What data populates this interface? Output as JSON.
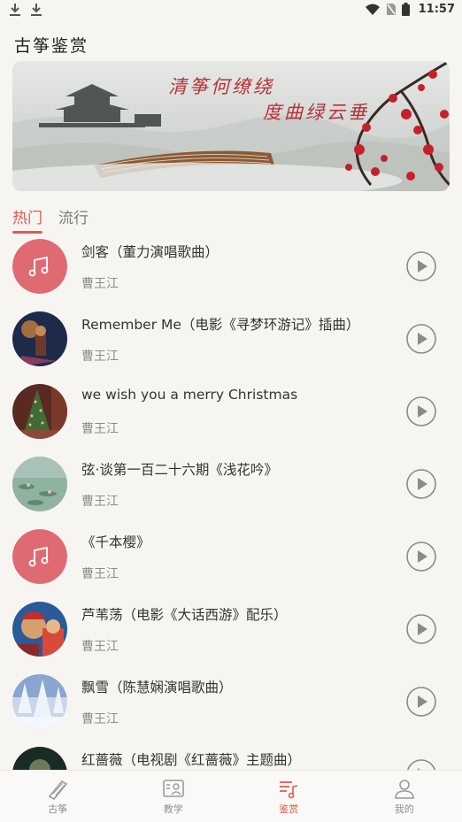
{
  "status_bar": {
    "time": "11:57"
  },
  "page": {
    "title": "古筝鉴赏"
  },
  "banner": {
    "line1": "清筝何缭绕",
    "line2": "度曲绿云垂"
  },
  "tabs": [
    {
      "label": "热门",
      "active": true
    },
    {
      "label": "流行",
      "active": false
    }
  ],
  "songs": [
    {
      "title": "剑客（董力演唱歌曲）",
      "artist": "曹王江",
      "cover": "music-note-placeholder"
    },
    {
      "title": "Remember Me（电影《寻梦环游记》插曲）",
      "artist": "曹王江",
      "cover": "coco-movie"
    },
    {
      "title": "we wish you a merry Christmas",
      "artist": "曹王江",
      "cover": "christmas-tree"
    },
    {
      "title": "弦·谈第一百二十六期《浅花吟》",
      "artist": "曹王江",
      "cover": "water-lilies"
    },
    {
      "title": "《千本樱》",
      "artist": "曹王江",
      "cover": "music-note-placeholder"
    },
    {
      "title": "芦苇荡（电影《大话西游》配乐）",
      "artist": "曹王江",
      "cover": "movie-still"
    },
    {
      "title": "飘雪（陈慧娴演唱歌曲）",
      "artist": "曹王江",
      "cover": "snowy-trees"
    },
    {
      "title": "红蔷薇（电视剧《红蔷薇》主题曲）",
      "artist": "",
      "cover": "dark-portrait"
    }
  ],
  "bottom_nav": [
    {
      "label": "古筝",
      "icon": "guzheng-icon",
      "active": false
    },
    {
      "label": "教学",
      "icon": "teaching-icon",
      "active": false
    },
    {
      "label": "鉴赏",
      "icon": "appreciation-icon",
      "active": true
    },
    {
      "label": "我的",
      "icon": "profile-icon",
      "active": false
    }
  ],
  "colors": {
    "accent": "#e25a4e",
    "placeholder_cover": "#e06a72",
    "background": "#f7f5f2"
  }
}
